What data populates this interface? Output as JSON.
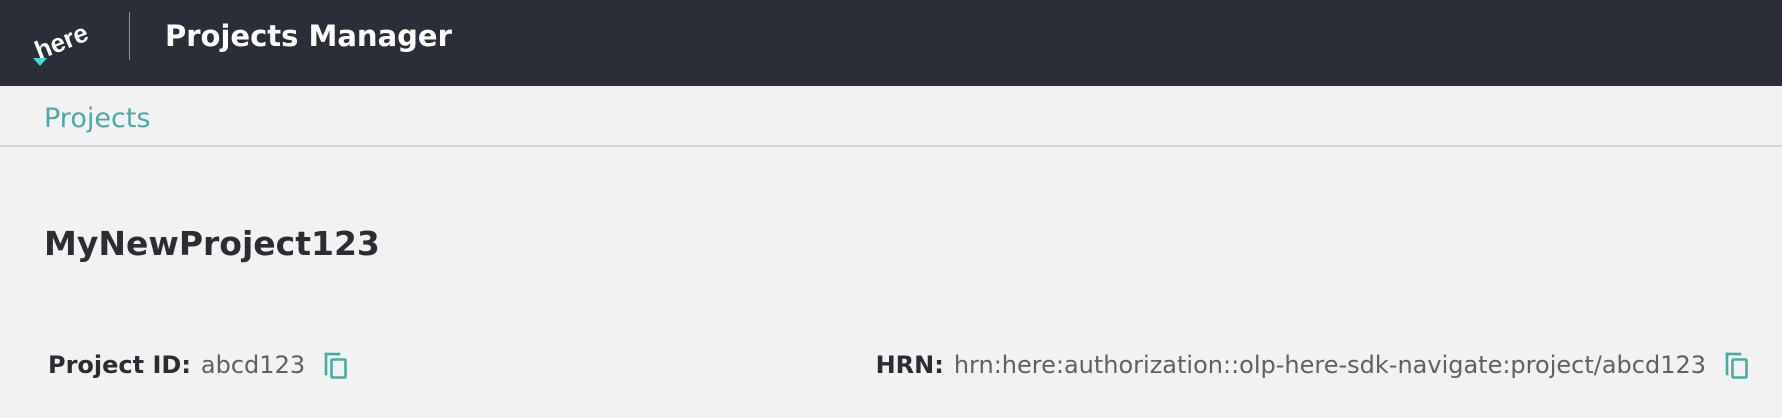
{
  "header": {
    "logo_text": "here",
    "app_title": "Projects Manager"
  },
  "breadcrumb": {
    "link_label": "Projects"
  },
  "project": {
    "name": "MyNewProject123",
    "id_label": "Project ID:",
    "id_value": "abcd123",
    "hrn_label": "HRN:",
    "hrn_value": "hrn:here:authorization::olp-here-sdk-navigate:project/abcd123"
  },
  "icons": {
    "copy": "copy-icon",
    "logo": "here-logo"
  },
  "colors": {
    "topbar": "#2a2e37",
    "accent": "#4aa9a4",
    "page_bg": "#f2f2f2"
  }
}
